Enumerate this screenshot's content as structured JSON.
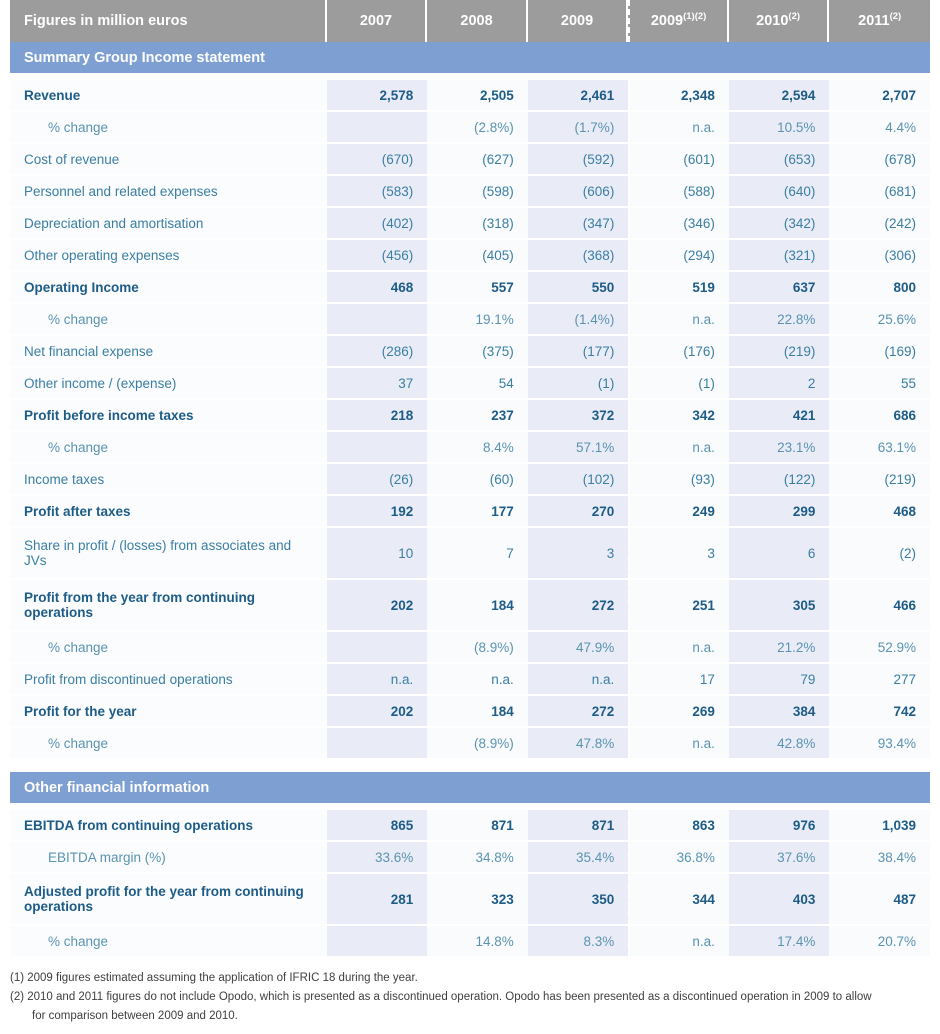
{
  "table": {
    "header": {
      "label_col": "Figures in million euros",
      "years": [
        {
          "year": "2007",
          "sup": ""
        },
        {
          "year": "2008",
          "sup": ""
        },
        {
          "year": "2009",
          "sup": ""
        },
        {
          "year": "2009",
          "sup": "(1)(2)"
        },
        {
          "year": "2010",
          "sup": "(2)"
        },
        {
          "year": "2011",
          "sup": "(2)"
        }
      ]
    },
    "sections": [
      {
        "title": "Summary Group Income statement",
        "rows": [
          {
            "label": "Revenue",
            "style": "bold",
            "values": [
              "2,578",
              "2,505",
              "2,461",
              "2,348",
              "2,594",
              "2,707"
            ]
          },
          {
            "label": "% change",
            "style": "sub",
            "values": [
              "",
              "(2.8%)",
              "(1.7%)",
              "n.a.",
              "10.5%",
              "4.4%"
            ]
          },
          {
            "label": "Cost of revenue",
            "style": "normal",
            "values": [
              "(670)",
              "(627)",
              "(592)",
              "(601)",
              "(653)",
              "(678)"
            ]
          },
          {
            "label": "Personnel and related expenses",
            "style": "normal",
            "values": [
              "(583)",
              "(598)",
              "(606)",
              "(588)",
              "(640)",
              "(681)"
            ]
          },
          {
            "label": "Depreciation and amortisation",
            "style": "normal",
            "values": [
              "(402)",
              "(318)",
              "(347)",
              "(346)",
              "(342)",
              "(242)"
            ]
          },
          {
            "label": "Other operating expenses",
            "style": "normal",
            "values": [
              "(456)",
              "(405)",
              "(368)",
              "(294)",
              "(321)",
              "(306)"
            ]
          },
          {
            "label": "Operating Income",
            "style": "bold",
            "values": [
              "468",
              "557",
              "550",
              "519",
              "637",
              "800"
            ]
          },
          {
            "label": "% change",
            "style": "sub",
            "values": [
              "",
              "19.1%",
              "(1.4%)",
              "n.a.",
              "22.8%",
              "25.6%"
            ]
          },
          {
            "label": "Net financial expense",
            "style": "normal",
            "values": [
              "(286)",
              "(375)",
              "(177)",
              "(176)",
              "(219)",
              "(169)"
            ]
          },
          {
            "label": "Other income / (expense)",
            "style": "normal",
            "values": [
              "37",
              "54",
              "(1)",
              "(1)",
              "2",
              "55"
            ]
          },
          {
            "label": "Profit before income taxes",
            "style": "bold",
            "values": [
              "218",
              "237",
              "372",
              "342",
              "421",
              "686"
            ]
          },
          {
            "label": "% change",
            "style": "sub",
            "values": [
              "",
              "8.4%",
              "57.1%",
              "n.a.",
              "23.1%",
              "63.1%"
            ]
          },
          {
            "label": "Income taxes",
            "style": "normal",
            "values": [
              "(26)",
              "(60)",
              "(102)",
              "(93)",
              "(122)",
              "(219)"
            ]
          },
          {
            "label": "Profit after taxes",
            "style": "bold",
            "values": [
              "192",
              "177",
              "270",
              "249",
              "299",
              "468"
            ]
          },
          {
            "label": "Share in profit / (losses) from associates and JVs",
            "style": "normal tall",
            "values": [
              "10",
              "7",
              "3",
              "3",
              "6",
              "(2)"
            ]
          },
          {
            "label": "Profit from the year from continuing operations",
            "style": "bold tall",
            "values": [
              "202",
              "184",
              "272",
              "251",
              "305",
              "466"
            ]
          },
          {
            "label": "% change",
            "style": "sub",
            "values": [
              "",
              "(8.9%)",
              "47.9%",
              "n.a.",
              "21.2%",
              "52.9%"
            ]
          },
          {
            "label": "Profit from discontinued operations",
            "style": "normal",
            "values": [
              "n.a.",
              "n.a.",
              "n.a.",
              "17",
              "79",
              "277"
            ]
          },
          {
            "label": "Profit for the year",
            "style": "bold",
            "values": [
              "202",
              "184",
              "272",
              "269",
              "384",
              "742"
            ]
          },
          {
            "label": "% change",
            "style": "sub",
            "values": [
              "",
              "(8.9%)",
              "47.8%",
              "n.a.",
              "42.8%",
              "93.4%"
            ]
          }
        ]
      },
      {
        "title": "Other financial information",
        "rows": [
          {
            "label": "EBITDA from continuing operations",
            "style": "bold",
            "values": [
              "865",
              "871",
              "871",
              "863",
              "976",
              "1,039"
            ]
          },
          {
            "label": "EBITDA margin (%)",
            "style": "sub",
            "values": [
              "33.6%",
              "34.8%",
              "35.4%",
              "36.8%",
              "37.6%",
              "38.4%"
            ]
          },
          {
            "label": "Adjusted profit for the year from continuing operations",
            "style": "bold tall",
            "values": [
              "281",
              "323",
              "350",
              "344",
              "403",
              "487"
            ]
          },
          {
            "label": "% change",
            "style": "sub",
            "values": [
              "",
              "14.8%",
              "8.3%",
              "n.a.",
              "17.4%",
              "20.7%"
            ]
          }
        ]
      }
    ]
  },
  "footnotes": [
    {
      "text": "(1) 2009 figures estimated assuming the application of IFRIC 18 during the year.",
      "cont": ""
    },
    {
      "text": "(2) 2010 and 2011 figures do not include Opodo, which is presented as a discontinued operation. Opodo has been presented as a discontinued operation in 2009 to allow",
      "cont": "for comparison between 2009 and 2010."
    }
  ],
  "colors": {
    "header_gray": "#9c9c9c",
    "section_blue": "#7e9fd2",
    "tint_a": "#e9ecf6",
    "tint_b": "#fafbfd",
    "text_blue": "#3a7ea3",
    "text_bold_blue": "#1d5c87"
  }
}
